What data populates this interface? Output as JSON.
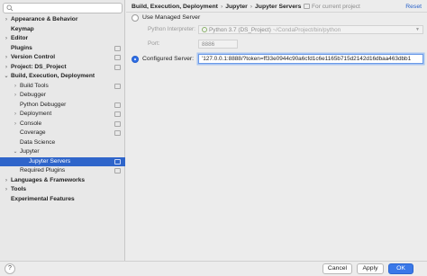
{
  "search": {
    "value": "",
    "icon": "search-icon"
  },
  "sidebar": {
    "items": [
      {
        "label": "Appearance & Behavior",
        "arrow": "›",
        "bold": true,
        "indent": 0
      },
      {
        "label": "Keymap",
        "arrow": "",
        "bold": true,
        "indent": 0
      },
      {
        "label": "Editor",
        "arrow": "›",
        "bold": true,
        "indent": 0
      },
      {
        "label": "Plugins",
        "arrow": "",
        "bold": true,
        "indent": 0,
        "project": true
      },
      {
        "label": "Version Control",
        "arrow": "›",
        "bold": true,
        "indent": 0,
        "project": true
      },
      {
        "label": "Project: DS_Project",
        "arrow": "›",
        "bold": true,
        "indent": 0,
        "project": true
      },
      {
        "label": "Build, Execution, Deployment",
        "arrow": "⌄",
        "bold": true,
        "indent": 0
      },
      {
        "label": "Build Tools",
        "arrow": "›",
        "bold": false,
        "indent": 1,
        "project": true
      },
      {
        "label": "Debugger",
        "arrow": "›",
        "bold": false,
        "indent": 1
      },
      {
        "label": "Python Debugger",
        "arrow": "",
        "bold": false,
        "indent": 1,
        "project": true
      },
      {
        "label": "Deployment",
        "arrow": "›",
        "bold": false,
        "indent": 1,
        "project": true
      },
      {
        "label": "Console",
        "arrow": "›",
        "bold": false,
        "indent": 1,
        "project": true
      },
      {
        "label": "Coverage",
        "arrow": "",
        "bold": false,
        "indent": 1,
        "project": true
      },
      {
        "label": "Data Science",
        "arrow": "",
        "bold": false,
        "indent": 1
      },
      {
        "label": "Jupyter",
        "arrow": "⌄",
        "bold": false,
        "indent": 1
      },
      {
        "label": "Jupyter Servers",
        "arrow": "",
        "bold": false,
        "indent": 2,
        "project": true,
        "selected": true
      },
      {
        "label": "Required Plugins",
        "arrow": "",
        "bold": false,
        "indent": 1,
        "project": true
      },
      {
        "label": "Languages & Frameworks",
        "arrow": "›",
        "bold": true,
        "indent": 0
      },
      {
        "label": "Tools",
        "arrow": "›",
        "bold": true,
        "indent": 0
      },
      {
        "label": "Experimental Features",
        "arrow": "",
        "bold": true,
        "indent": 0
      }
    ]
  },
  "header": {
    "breadcrumb": [
      "Build, Execution, Deployment",
      "Jupyter",
      "Jupyter Servers"
    ],
    "separator": "›",
    "current_project": "For current project",
    "reset": "Reset"
  },
  "settings": {
    "managed_label": "Use Managed Server",
    "interpreter_label": "Python Interpreter:",
    "interpreter_value": "Python 3.7 (DS_Project)",
    "interpreter_path": "~/CondaProject/bin/python",
    "port_label": "Port:",
    "port_value": "8886",
    "configured_label": "Configured Server:",
    "configured_value": "'127.0.0.1:8888/?token=ff33e0944c90a6cfd1c6e1165b715d2142d16dbaa463dbb1"
  },
  "footer": {
    "help": "?",
    "cancel": "Cancel",
    "apply": "Apply",
    "ok": "OK"
  },
  "colors": {
    "selection": "#2f65ca",
    "primary_button": "#3a78e8",
    "link": "#2a62c9"
  }
}
